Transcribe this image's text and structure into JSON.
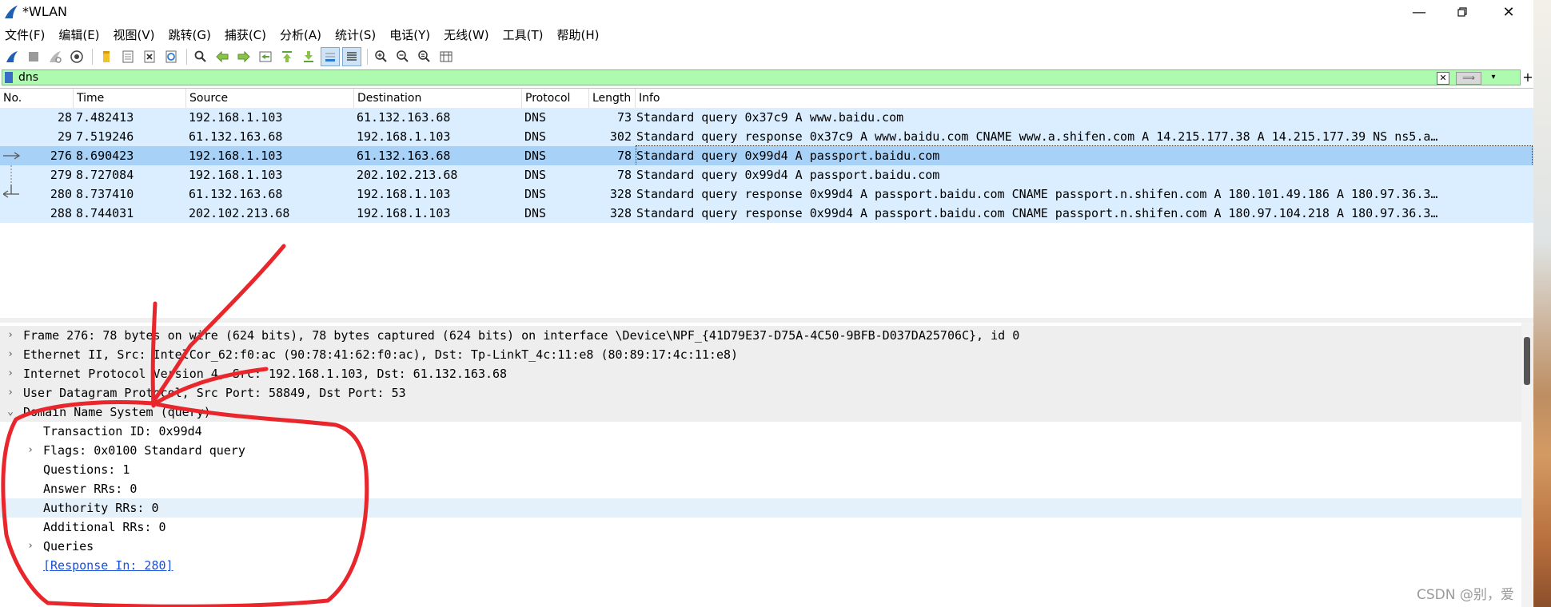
{
  "window": {
    "title": "*WLAN",
    "controls": [
      "minimize-icon",
      "restore-icon",
      "close-icon"
    ]
  },
  "menu": [
    {
      "label": "文件(F)"
    },
    {
      "label": "编辑(E)"
    },
    {
      "label": "视图(V)"
    },
    {
      "label": "跳转(G)"
    },
    {
      "label": "捕获(C)"
    },
    {
      "label": "分析(A)"
    },
    {
      "label": "统计(S)"
    },
    {
      "label": "电话(Y)"
    },
    {
      "label": "无线(W)"
    },
    {
      "label": "工具(T)"
    },
    {
      "label": "帮助(H)"
    }
  ],
  "toolbar_icons": [
    "start-capture-icon",
    "stop-capture-icon",
    "restart-capture-icon",
    "capture-options-icon",
    "open-file-icon",
    "save-file-icon",
    "close-file-icon",
    "reload-file-icon",
    "find-packet-icon",
    "go-back-icon",
    "go-forward-icon",
    "go-to-packet-icon",
    "first-packet-icon",
    "last-packet-icon",
    "autoscroll-icon",
    "colorize-icon",
    "zoom-in-icon",
    "zoom-out-icon",
    "zoom-normal-icon",
    "resize-columns-icon"
  ],
  "filter": {
    "value": "dns"
  },
  "columns": [
    "No.",
    "Time",
    "Source",
    "Destination",
    "Protocol",
    "Length",
    "Info"
  ],
  "packets": [
    {
      "no": "28",
      "time": "7.482413",
      "src": "192.168.1.103",
      "dst": "61.132.163.68",
      "proto": "DNS",
      "len": "73",
      "info": "Standard query 0x37c9 A www.baidu.com"
    },
    {
      "no": "29",
      "time": "7.519246",
      "src": "61.132.163.68",
      "dst": "192.168.1.103",
      "proto": "DNS",
      "len": "302",
      "info": "Standard query response 0x37c9 A www.baidu.com CNAME www.a.shifen.com A 14.215.177.38 A 14.215.177.39 NS ns5.a…"
    },
    {
      "no": "276",
      "time": "8.690423",
      "src": "192.168.1.103",
      "dst": "61.132.163.68",
      "proto": "DNS",
      "len": "78",
      "info": "Standard query 0x99d4 A passport.baidu.com"
    },
    {
      "no": "279",
      "time": "8.727084",
      "src": "192.168.1.103",
      "dst": "202.102.213.68",
      "proto": "DNS",
      "len": "78",
      "info": "Standard query 0x99d4 A passport.baidu.com"
    },
    {
      "no": "280",
      "time": "8.737410",
      "src": "61.132.163.68",
      "dst": "192.168.1.103",
      "proto": "DNS",
      "len": "328",
      "info": "Standard query response 0x99d4 A passport.baidu.com CNAME passport.n.shifen.com A 180.101.49.186 A 180.97.36.3…"
    },
    {
      "no": "288",
      "time": "8.744031",
      "src": "202.102.213.68",
      "dst": "192.168.1.103",
      "proto": "DNS",
      "len": "328",
      "info": "Standard query response 0x99d4 A passport.baidu.com CNAME passport.n.shifen.com A 180.97.104.218 A 180.97.36.3…"
    }
  ],
  "details": [
    {
      "text": "Frame 276: 78 bytes on wire (624 bits), 78 bytes captured (624 bits) on interface \\Device\\NPF_{41D79E37-D75A-4C50-9BFB-D037DA25706C}, id 0",
      "chevron": "›"
    },
    {
      "text": "Ethernet II, Src: IntelCor_62:f0:ac (90:78:41:62:f0:ac), Dst: Tp-LinkT_4c:11:e8 (80:89:17:4c:11:e8)",
      "chevron": "›"
    },
    {
      "text": "Internet Protocol Version 4, Src: 192.168.1.103, Dst: 61.132.163.68",
      "chevron": "›"
    },
    {
      "text": "User Datagram Protocol, Src Port: 58849, Dst Port: 53",
      "chevron": "›"
    },
    {
      "text": "Domain Name System (query)",
      "chevron": "⌄"
    },
    {
      "text": "Transaction ID: 0x99d4",
      "chevron": ""
    },
    {
      "text": "Flags: 0x0100 Standard query",
      "chevron": "›"
    },
    {
      "text": "Questions: 1",
      "chevron": ""
    },
    {
      "text": "Answer RRs: 0",
      "chevron": ""
    },
    {
      "text": "Authority RRs: 0",
      "chevron": ""
    },
    {
      "text": "Additional RRs: 0",
      "chevron": ""
    },
    {
      "text": "Queries",
      "chevron": "›"
    },
    {
      "text": "[Response In: 280]",
      "chevron": ""
    }
  ],
  "watermark": "CSDN @别，爱",
  "colors": {
    "filter_bg": "#aefaae",
    "row_bg": "#daeeff",
    "row_selected": "#a8d1f7",
    "annotation": "#e8262b"
  }
}
